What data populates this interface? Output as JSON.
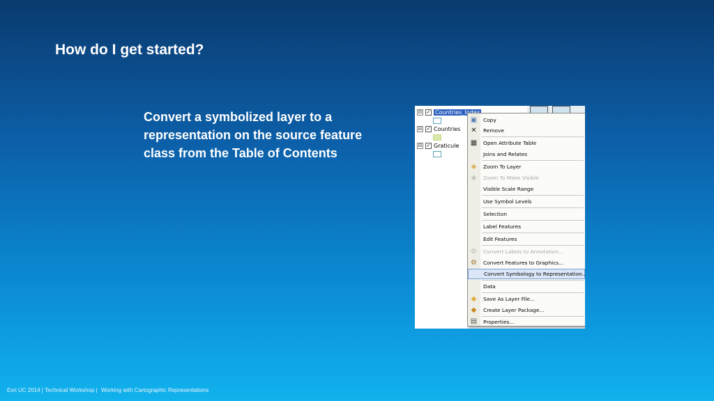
{
  "slide": {
    "title": "How do I get started?",
    "body": "Convert a symbolized layer to a representation on the source feature class from the Table of Contents"
  },
  "footer": {
    "event": "Esri UC 2014 | Technical Workshop |",
    "session": "Working with Cartographic Representations"
  },
  "toc": {
    "layers": [
      {
        "name": "Countries_Index",
        "checked": true,
        "selected": true
      },
      {
        "name": "Countries",
        "checked": true,
        "selected": false
      },
      {
        "name": "Graticule",
        "checked": true,
        "selected": false
      }
    ],
    "expand_glyph": "⊟",
    "check_glyph": "✓"
  },
  "context_menu": {
    "items": [
      {
        "label": "Copy",
        "icon": "copy-icon",
        "glyph": "📄",
        "disabled": false
      },
      {
        "label": "Remove",
        "icon": "remove-icon",
        "glyph": "✕",
        "disabled": false
      },
      {
        "label": "Open Attribute Table",
        "icon": "table-icon",
        "glyph": "▦",
        "disabled": false
      },
      {
        "label": "Joins and Relates",
        "icon": "",
        "glyph": "",
        "disabled": false
      },
      {
        "label": "Zoom To Layer",
        "icon": "zoom-to-layer-icon",
        "glyph": "◈",
        "disabled": false
      },
      {
        "label": "Zoom To Make Visible",
        "icon": "zoom-to-visible-icon",
        "glyph": "◈",
        "disabled": true
      },
      {
        "label": "Visible Scale Range",
        "icon": "",
        "glyph": "",
        "disabled": false
      },
      {
        "label": "Use Symbol Levels",
        "icon": "",
        "glyph": "",
        "disabled": false
      },
      {
        "label": "Selection",
        "icon": "",
        "glyph": "",
        "disabled": false
      },
      {
        "label": "Label Features",
        "icon": "",
        "glyph": "",
        "disabled": false
      },
      {
        "label": "Edit Features",
        "icon": "",
        "glyph": "",
        "disabled": false
      },
      {
        "label": "Convert Labels to Annotation...",
        "icon": "convert-labels-icon",
        "glyph": "⚙",
        "disabled": true
      },
      {
        "label": "Convert Features to Graphics...",
        "icon": "convert-graphics-icon",
        "glyph": "⚙",
        "disabled": false
      },
      {
        "label": "Convert Symbology to Representation...",
        "icon": "",
        "glyph": "",
        "disabled": false,
        "highlight": true
      },
      {
        "label": "Data",
        "icon": "",
        "glyph": "",
        "disabled": false
      },
      {
        "label": "Save As Layer File...",
        "icon": "layer-file-icon",
        "glyph": "◆",
        "disabled": false
      },
      {
        "label": "Create Layer Package...",
        "icon": "layer-package-icon",
        "glyph": "◆",
        "disabled": false
      },
      {
        "label": "Properties...",
        "icon": "properties-icon",
        "glyph": "▤",
        "disabled": false
      }
    ]
  },
  "colors": {
    "selection": "#2b5fbf",
    "highlight": "#dbe7f8"
  }
}
